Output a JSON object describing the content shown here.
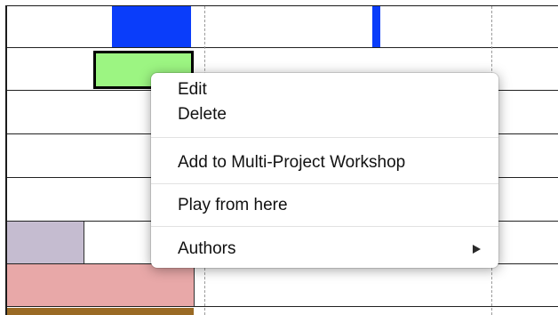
{
  "context_menu": {
    "items": [
      {
        "label": "Edit"
      },
      {
        "label": "Delete"
      },
      {
        "label": "Add to Multi-Project Workshop"
      },
      {
        "label": "Play from here"
      },
      {
        "label": "Authors",
        "submenu_icon": "triangle-right-icon"
      }
    ]
  },
  "timeline": {
    "lanes": 8,
    "blocks": [
      {
        "name": "blue-block",
        "color": "#0a3dfa"
      },
      {
        "name": "blue-marker",
        "color": "#0a3dfa"
      },
      {
        "name": "green-block-selected",
        "color": "#9cf582",
        "selected": true
      },
      {
        "name": "lavender-block",
        "color": "#c5bcd0"
      },
      {
        "name": "pink-block",
        "color": "#e8a8a8"
      },
      {
        "name": "brown-block",
        "color": "#9a6a24"
      }
    ]
  }
}
